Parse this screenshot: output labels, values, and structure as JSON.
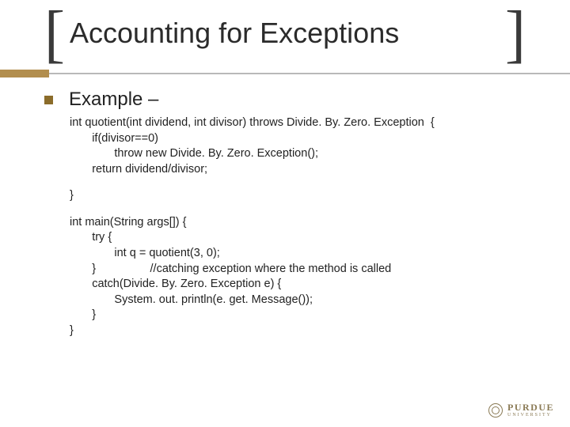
{
  "title": "Accounting for Exceptions",
  "bullet_label": "Example –",
  "code": {
    "l01": "int quotient(int dividend, int divisor) throws Divide. By. Zero. Exception  {",
    "l02": "       if(divisor==0)",
    "l03": "              throw new Divide. By. Zero. Exception();",
    "l04": "       return dividend/divisor;",
    "l05": "}",
    "l06": "int main(String args[]) {",
    "l07": "       try {",
    "l08": "              int q = quotient(3, 0);",
    "l09": "       }                 //catching exception where the method is called",
    "l10": "       catch(Divide. By. Zero. Exception e) {",
    "l11": "              System. out. println(e. get. Message());",
    "l12": "       }",
    "l13": "}"
  },
  "logo": {
    "main": "PURDUE",
    "sub": "UNIVERSITY"
  },
  "colors": {
    "accent": "#b28e4e",
    "bullet": "#8b6c2a",
    "text": "#222222"
  }
}
